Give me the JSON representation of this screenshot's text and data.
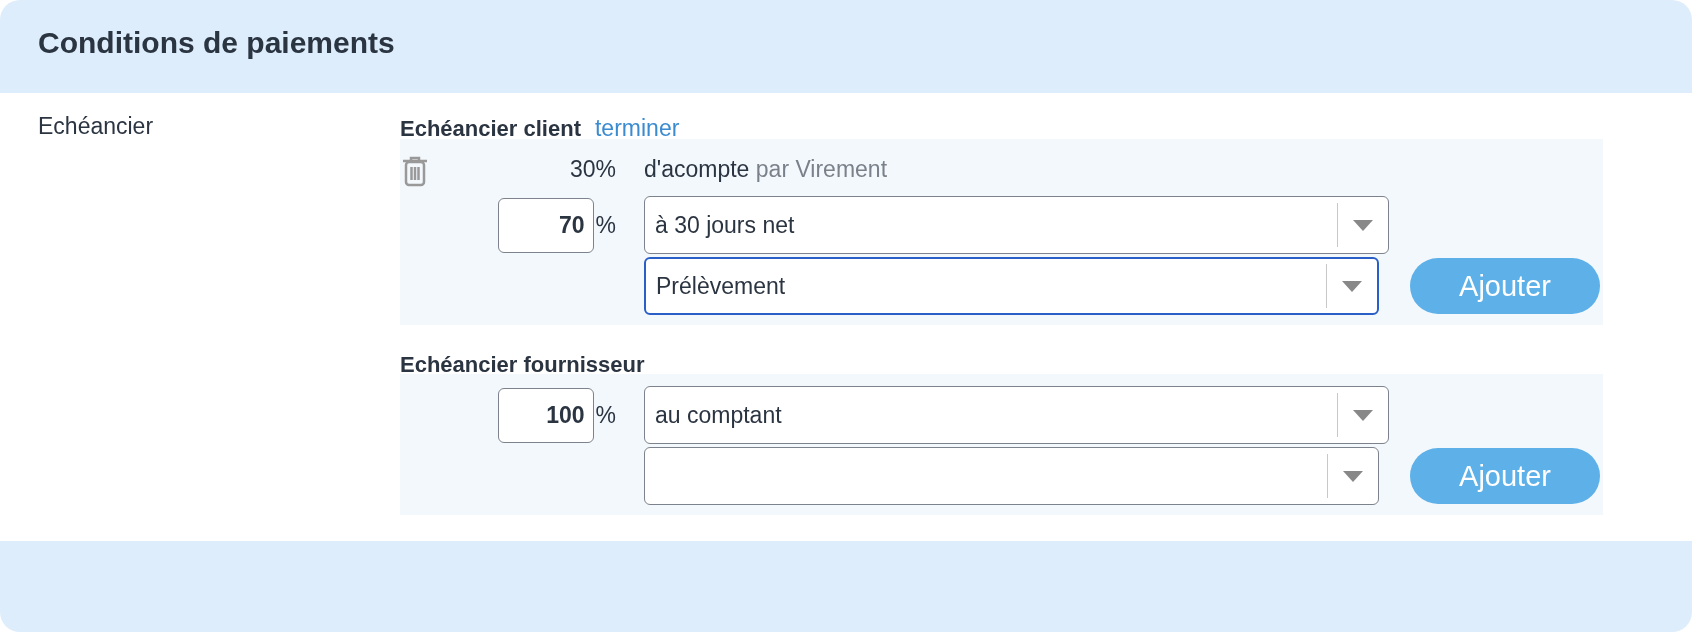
{
  "title": "Conditions de paiements",
  "section": {
    "label": "Echéancier",
    "schedules": [
      {
        "title": "Echéancier client",
        "link": "terminer",
        "deposit": {
          "percent": "30%",
          "label": "d'acompte",
          "method": "par Virement"
        },
        "line": {
          "percent": "70",
          "unit": "%"
        },
        "selects": [
          {
            "value": "à 30 jours net",
            "focused": false
          },
          {
            "value": "Prélèvement",
            "focused": true
          }
        ],
        "button": "Ajouter"
      },
      {
        "title": "Echéancier fournisseur",
        "line": {
          "percent": "100",
          "unit": "%"
        },
        "selects": [
          {
            "value": "au comptant",
            "focused": false
          },
          {
            "focused": false
          }
        ],
        "button": "Ajouter"
      }
    ]
  }
}
